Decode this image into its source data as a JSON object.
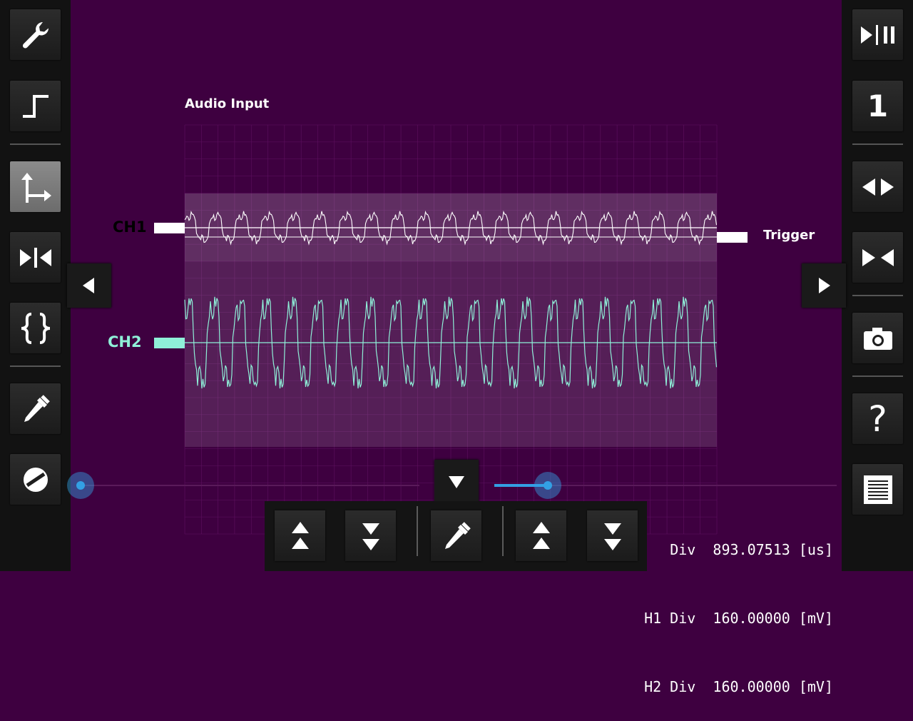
{
  "screen": {
    "title": "Audio Input"
  },
  "channels": {
    "ch1": {
      "label": "CH1",
      "color": "#ffffff"
    },
    "ch2": {
      "label": "CH2",
      "color": "#8ff0d8"
    }
  },
  "trigger": {
    "label": "Trigger"
  },
  "left_toolbar": {
    "items": [
      "wrench-icon",
      "step-signal-icon",
      "axes-arrows-icon",
      "collapse-horizontal-icon",
      "braces-icon",
      "pipette-icon",
      "cancel-circle-icon"
    ],
    "active": "axes-arrows-icon"
  },
  "right_toolbar": {
    "channel_number": "1",
    "help_label": "?"
  },
  "readout": {
    "row1": {
      "label": "Div",
      "value": "893.07513",
      "unit": "[us]"
    },
    "row2": {
      "label": "H1 Div",
      "value": "160.00000",
      "unit": "[mV]"
    },
    "row3": {
      "label": "H2 Div",
      "value": "160.00000",
      "unit": "[mV]"
    }
  },
  "colors": {
    "background": "#3e0040",
    "accent_blue": "#33a0e4",
    "grid": "#5e1060"
  }
}
